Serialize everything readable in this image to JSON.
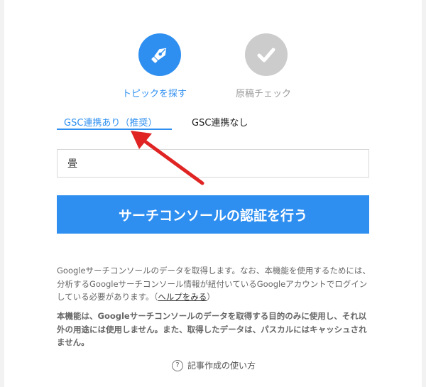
{
  "steps": [
    {
      "label": "トピックを探す",
      "icon": "fountain-pen-icon",
      "color": "#2f8ff0",
      "active": true
    },
    {
      "label": "原稿チェック",
      "icon": "checkmark-icon",
      "color": "#cccccc",
      "active": false
    }
  ],
  "tabs": [
    {
      "label": "GSC連携あり（推奨）",
      "active": true
    },
    {
      "label": "GSC連携なし",
      "active": false
    }
  ],
  "input": {
    "value": "畳"
  },
  "auth_button": {
    "label": "サーチコンソールの認証を行う"
  },
  "description": {
    "text": "Googleサーチコンソールのデータを取得します。なお、本機能を使用するためには、分析するGoogleサーチコンソール情報が紐付いているGoogleアカウントでログインしている必要があります。（",
    "help_link": "ヘルプをみる",
    "text_end": "）"
  },
  "notice": "本機能は、Googleサーチコンソールのデータを取得する目的のみに使用し、それ以外の用途には使用しません。また、取得したデータは、パスカルにはキャッシュされません。",
  "howto": {
    "label": "記事作成の使い方",
    "icon": "question-circle-icon"
  },
  "colors": {
    "accent": "#2f8ff0",
    "annotation_arrow": "#e02424"
  }
}
